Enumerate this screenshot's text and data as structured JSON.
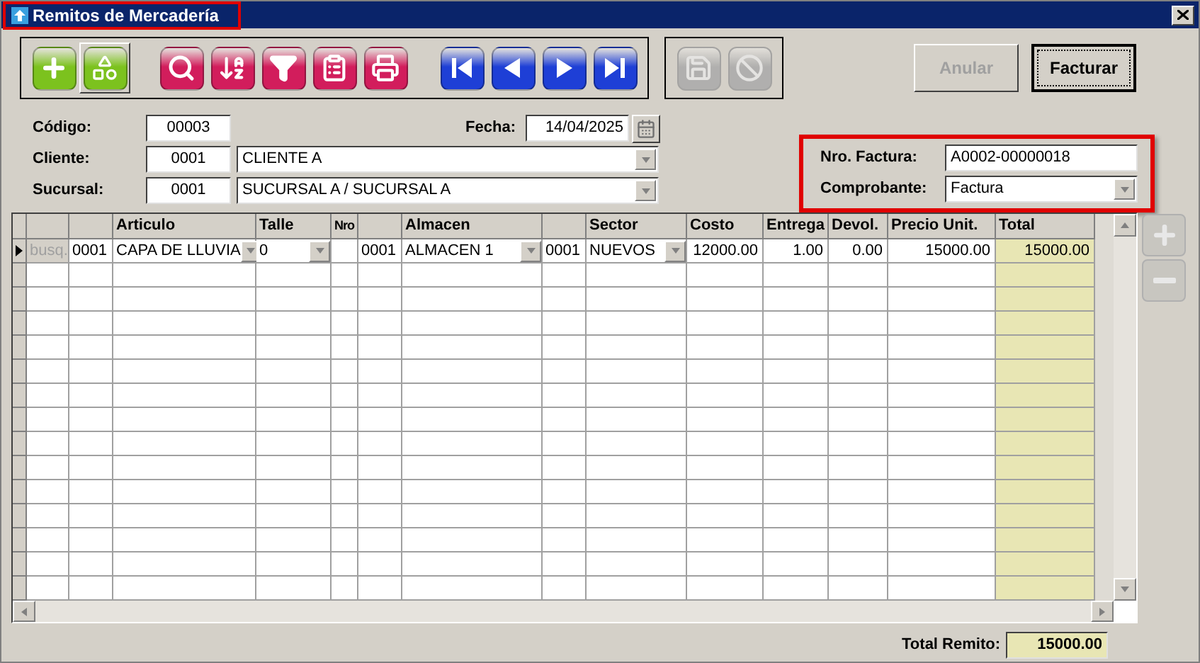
{
  "window": {
    "title": "Remitos de Mercadería"
  },
  "toolbar": [
    {
      "buttons": [
        {
          "kind": "new",
          "color": "#7cc21e",
          "pressed": false,
          "disabled": false
        },
        {
          "kind": "items",
          "color": "#7cc21e",
          "pressed": true,
          "disabled": false
        },
        {
          "kind": "search",
          "color": "#d21d5c",
          "pressed": false,
          "disabled": false
        },
        {
          "kind": "sort",
          "color": "#d21d5c",
          "pressed": false,
          "disabled": false
        },
        {
          "kind": "filter",
          "color": "#d21d5c",
          "pressed": false,
          "disabled": false
        },
        {
          "kind": "report",
          "color": "#d21d5c",
          "pressed": false,
          "disabled": false
        },
        {
          "kind": "print",
          "color": "#d21d5c",
          "pressed": false,
          "disabled": false
        },
        {
          "kind": "first",
          "color": "#1e3fd6",
          "pressed": false,
          "disabled": false
        },
        {
          "kind": "prev",
          "color": "#1e3fd6",
          "pressed": false,
          "disabled": false
        },
        {
          "kind": "next",
          "color": "#1e3fd6",
          "pressed": false,
          "disabled": false
        },
        {
          "kind": "last",
          "color": "#1e3fd6",
          "pressed": false,
          "disabled": false
        }
      ]
    },
    {
      "buttons": [
        {
          "kind": "save",
          "color": "#a8a8a8",
          "pressed": false,
          "disabled": true
        },
        {
          "kind": "cancel",
          "color": "#a8a8a8",
          "pressed": false,
          "disabled": true
        }
      ]
    }
  ],
  "actions": [
    {
      "label": "Anular",
      "disabled": true,
      "focused": false
    },
    {
      "label": "Facturar",
      "disabled": false,
      "focused": true
    }
  ],
  "form": {
    "codigo": {
      "label": "Código:",
      "value": "00003"
    },
    "fecha": {
      "label": "Fecha:",
      "value": "14/04/2025"
    },
    "cliente": {
      "label": "Cliente:",
      "code": "0001",
      "value": "CLIENTE A"
    },
    "sucursal": {
      "label": "Sucursal:",
      "code": "0001",
      "value": "SUCURSAL A / SUCURSAL A"
    }
  },
  "factura": {
    "nro": {
      "label": "Nro. Factura:",
      "value": "A0002-00000018"
    },
    "comprobante": {
      "label": "Comprobante:",
      "value": "Factura"
    }
  },
  "table": {
    "columns": {
      "articulo": "Articulo",
      "talle": "Talle",
      "nro": "Nro",
      "almacen": "Almacen",
      "sector": "Sector",
      "costo": "Costo",
      "entrega": "Entrega",
      "devol": "Devol.",
      "precio_unit": "Precio Unit.",
      "total": "Total"
    },
    "rows": [
      {
        "current": true,
        "cells": {
          "busq": "busq.",
          "code": "0001",
          "articulo": "CAPA DE LLUVIA",
          "talle": "0",
          "almacen_code": "0001",
          "almacen": "ALMACEN 1",
          "sector_code": "0001",
          "sector": "NUEVOS",
          "costo": "12000.00",
          "entrega": "1.00",
          "devol": "0.00",
          "precio_unit": "15000.00",
          "total": "15000.00"
        }
      }
    ]
  },
  "side_buttons": [
    {
      "kind": "add",
      "disabled": true
    },
    {
      "kind": "remove",
      "disabled": true
    }
  ],
  "total_remito": {
    "label": "Total Remito:",
    "value": "15000.00"
  }
}
